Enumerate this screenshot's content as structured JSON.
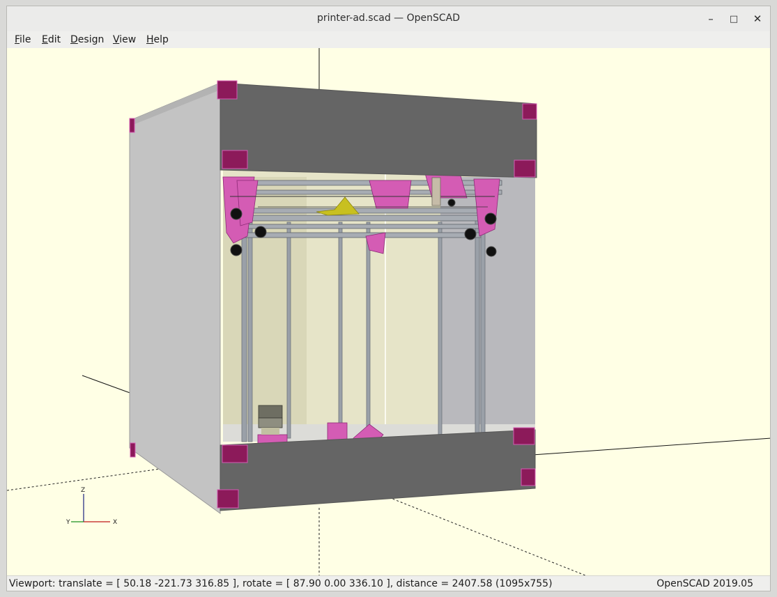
{
  "window": {
    "title": "printer-ad.scad — OpenSCAD",
    "controls": {
      "minimize": "–",
      "maximize": "□",
      "close": "✕"
    }
  },
  "menubar": {
    "items": [
      {
        "label": "File",
        "mnemonic": "F",
        "rest": "ile"
      },
      {
        "label": "Edit",
        "mnemonic": "E",
        "rest": "dit"
      },
      {
        "label": "Design",
        "mnemonic": "D",
        "rest": "esign"
      },
      {
        "label": "View",
        "mnemonic": "V",
        "rest": "iew"
      },
      {
        "label": "Help",
        "mnemonic": "H",
        "rest": "elp"
      }
    ]
  },
  "viewport": {
    "background": "#ffffe5",
    "axes_gizmo": {
      "x": "X",
      "y": "Y",
      "z": "Z"
    },
    "colors": {
      "panel_dark": "#646464",
      "panel_light": "#c4c4c4",
      "corner_bracket": "#8c1a5a",
      "printed_part": "#d45cb4",
      "extrusion": "#9aa0a8",
      "bed_glass": "#e4e2c4",
      "filament_part": "#c8c020"
    }
  },
  "statusbar": {
    "viewport_info": "Viewport: translate = [ 50.18 -221.73 316.85 ], rotate = [ 87.90 0.00 336.10 ], distance = 2407.58 (1095x755)",
    "version": "OpenSCAD 2019.05"
  }
}
